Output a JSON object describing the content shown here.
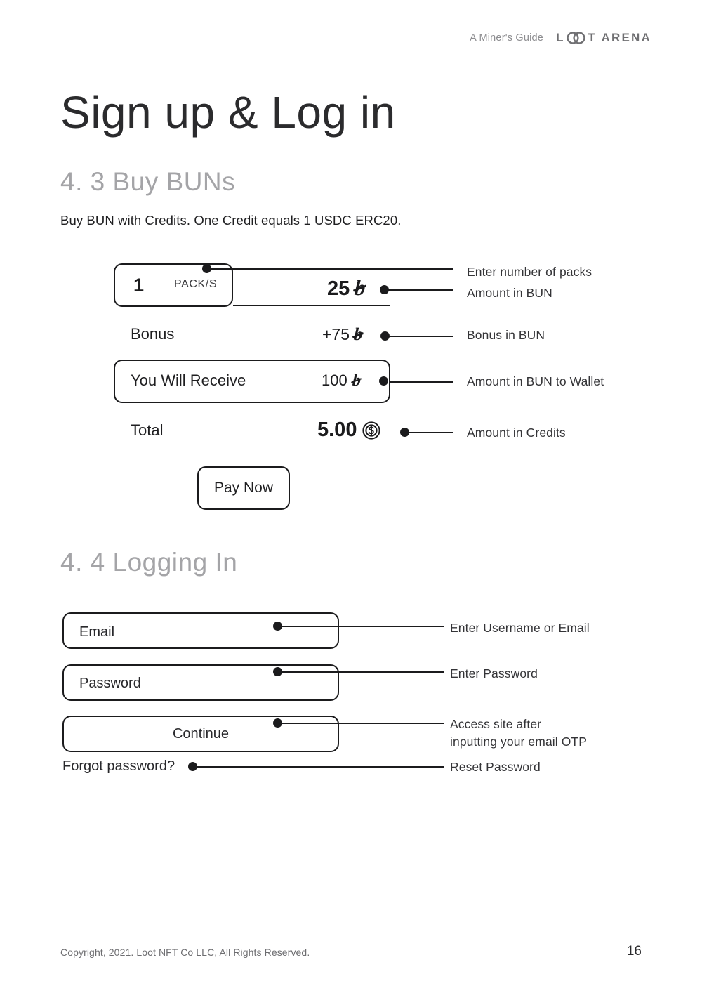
{
  "header": {
    "guide_label": "A Miner's Guide",
    "brand_prefix": "L",
    "brand_suffix": "T ARENA",
    "brand_full": "LOOT ARENA"
  },
  "page": {
    "main_title": "Sign up & Log in",
    "section_4_3": "4. 3 Buy BUNs",
    "section_4_4": "4. 4 Logging In",
    "intro": "Buy BUN with Credits. One Credit equals 1 USDC ERC20."
  },
  "buy_buns": {
    "packs_quantity": "1",
    "packs_unit": "PACK/S",
    "amount_value": "25",
    "amount_symbol": "♭",
    "bonus_label": "Bonus",
    "bonus_value": "+75",
    "bonus_symbol": "♭",
    "receive_label": "You Will Receive",
    "receive_value": "100",
    "receive_symbol": "♭",
    "total_label": "Total",
    "total_value": "5.00",
    "total_symbol": "credits-coin-icon",
    "pay_button": "Pay Now",
    "callouts": [
      "Enter number of packs",
      "Amount in BUN",
      "Bonus in BUN",
      "Amount in BUN to Wallet",
      "Amount in Credits"
    ]
  },
  "login": {
    "email_placeholder": "Email",
    "password_placeholder": "Password",
    "continue_label": "Continue",
    "forgot_label": "Forgot password?",
    "callouts": [
      "Enter Username or Email",
      "Enter Password",
      "Access site after\ninputting your email OTP",
      "Reset Password"
    ]
  },
  "footer": {
    "copyright": "Copyright, 2021. Loot NFT Co LLC, All Rights Reserved.",
    "page_number": "16"
  },
  "colors": {
    "ink": "#1b1b1d",
    "muted": "#a4a4a7",
    "logo_gray": "#6f6f72",
    "footer_gray": "#6d6d70"
  }
}
